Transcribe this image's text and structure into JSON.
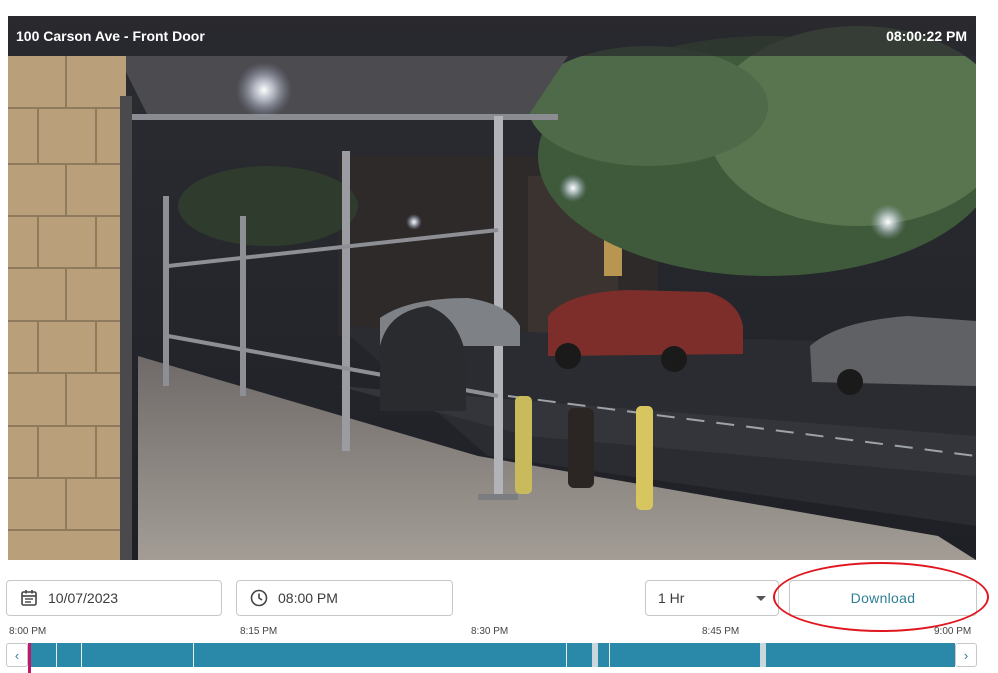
{
  "camera": {
    "name": "100 Carson Ave - Front Door",
    "timestamp": "08:00:22 PM"
  },
  "controls": {
    "date": "10/07/2023",
    "time": "08:00 PM",
    "duration": "1 Hr",
    "download_label": "Download",
    "date_icon": "calendar-icon",
    "time_icon": "clock-icon"
  },
  "timeline": {
    "ticks": [
      "8:00 PM",
      "8:15 PM",
      "8:30 PM",
      "8:45 PM",
      "9:00 PM"
    ],
    "prev_label": "‹",
    "next_label": "›",
    "playhead_fraction": 0.0
  },
  "colors": {
    "track": "#2a88a8",
    "playhead": "#c2186b",
    "download_text": "#2f7f99",
    "annotation": "#e0171f"
  }
}
